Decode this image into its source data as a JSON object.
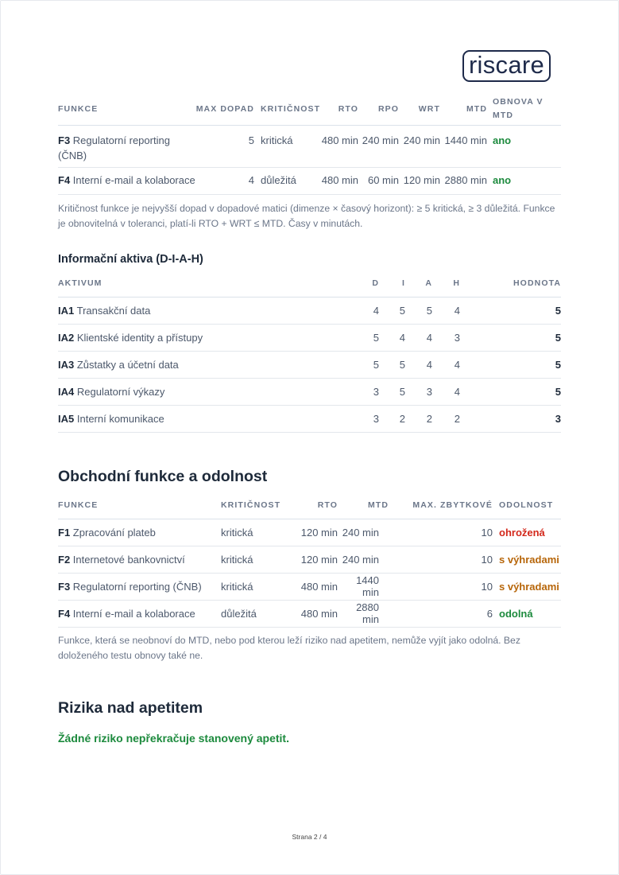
{
  "logo_text": "riscare",
  "table1": {
    "headers": [
      "FUNKCE",
      "MAX DOPAD",
      "KRITIČNOST",
      "RTO",
      "RPO",
      "WRT",
      "MTD",
      "OBNOVA V MTD"
    ],
    "rows": [
      {
        "code": "F3",
        "name": "Regulatorní reporting (ČNB)",
        "max": "5",
        "crit": "kritická",
        "rto": "480 min",
        "rpo": "240 min",
        "wrt": "240 min",
        "mtd": "1440 min",
        "obnova": "ano"
      },
      {
        "code": "F4",
        "name": "Interní e-mail a kolaborace",
        "max": "4",
        "crit": "důležitá",
        "rto": "480 min",
        "rpo": "60 min",
        "wrt": "120 min",
        "mtd": "2880 min",
        "obnova": "ano"
      }
    ]
  },
  "note1": "Kritičnost funkce je nejvyšší dopad v dopadové matici (dimenze × časový horizont): ≥ 5 kritická, ≥ 3 důležitá. Funkce je obnovitelná v toleranci, platí-li RTO + WRT ≤ MTD. Časy v minutách.",
  "assets": {
    "title": "Informační aktiva (D-I-A-H)",
    "headers": [
      "AKTIVUM",
      "D",
      "I",
      "A",
      "H",
      "HODNOTA"
    ],
    "rows": [
      {
        "code": "IA1",
        "name": "Transakční data",
        "d": "4",
        "i": "5",
        "a": "5",
        "h": "4",
        "val": "5"
      },
      {
        "code": "IA2",
        "name": "Klientské identity a přístupy",
        "d": "5",
        "i": "4",
        "a": "4",
        "h": "3",
        "val": "5"
      },
      {
        "code": "IA3",
        "name": "Zůstatky a účetní data",
        "d": "5",
        "i": "5",
        "a": "4",
        "h": "4",
        "val": "5"
      },
      {
        "code": "IA4",
        "name": "Regulatorní výkazy",
        "d": "3",
        "i": "5",
        "a": "3",
        "h": "4",
        "val": "5"
      },
      {
        "code": "IA5",
        "name": "Interní komunikace",
        "d": "3",
        "i": "2",
        "a": "2",
        "h": "2",
        "val": "3"
      }
    ]
  },
  "functions": {
    "title": "Obchodní funkce a odolnost",
    "headers": [
      "FUNKCE",
      "KRITIČNOST",
      "RTO",
      "MTD",
      "MAX. ZBYTKOVÉ",
      "ODOLNOST"
    ],
    "rows": [
      {
        "code": "F1",
        "name": "Zpracování plateb",
        "crit": "kritická",
        "rto": "120 min",
        "mtd": "240 min",
        "max": "10",
        "res": "ohrožená"
      },
      {
        "code": "F2",
        "name": "Internetové bankovnictví",
        "crit": "kritická",
        "rto": "120 min",
        "mtd": "240 min",
        "max": "10",
        "res": "s výhradami"
      },
      {
        "code": "F3",
        "name": "Regulatorní reporting (ČNB)",
        "crit": "kritická",
        "rto": "480 min",
        "mtd": "1440 min",
        "max": "10",
        "res": "s výhradami"
      },
      {
        "code": "F4",
        "name": "Interní e-mail a kolaborace",
        "crit": "důležitá",
        "rto": "480 min",
        "mtd": "2880 min",
        "max": "6",
        "res": "odolná"
      }
    ]
  },
  "note2": "Funkce, která se neobnoví do MTD, nebo pod kterou leží riziko nad apetitem, nemůže vyjít jako odolná. Bez doloženého testu obnovy také ne.",
  "risks": {
    "title": "Rizika nad apetitem",
    "status": "Žádné riziko nepřekračuje stanovený apetit."
  },
  "footer": "Strana 2 / 4",
  "colors": {
    "ok": "#1c8a3d",
    "danger": "#d3281b",
    "warning": "#b7660a",
    "heading": "#1e2a3a"
  }
}
